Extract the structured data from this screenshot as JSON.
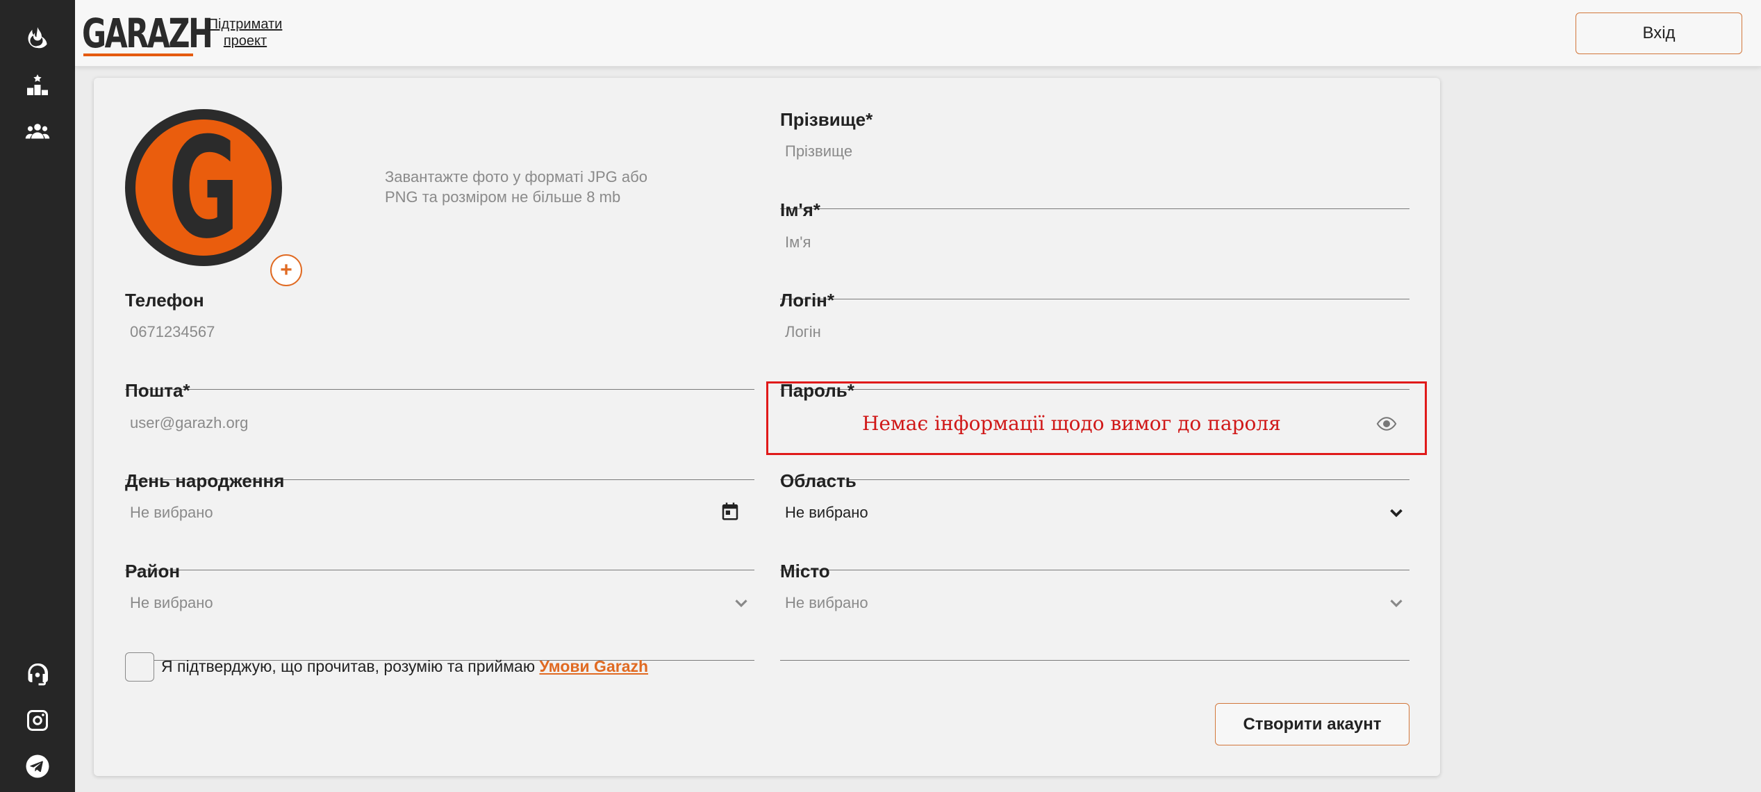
{
  "header": {
    "logo": "GARAZH",
    "support_link": "Підтримати проект",
    "login_button": "Вхід"
  },
  "sidebar": {
    "top_icons": [
      "fire-icon",
      "leaderboard-icon",
      "community-icon"
    ],
    "bottom_icons": [
      "support-headset-icon",
      "instagram-icon",
      "telegram-icon"
    ]
  },
  "form": {
    "avatar_letter": "G",
    "avatar_add": "+",
    "upload_hint": "Завантажте фото у форматі JPG або PNG та розміром не більше 8 mb",
    "surname": {
      "label": "Прізвище*",
      "placeholder": "Прізвище"
    },
    "first_name": {
      "label": "Ім'я*",
      "placeholder": "Ім'я"
    },
    "phone": {
      "label": "Телефон",
      "placeholder": "0671234567"
    },
    "login": {
      "label": "Логін*",
      "placeholder": "Логін"
    },
    "email": {
      "label": "Пошта*",
      "placeholder": "user@garazh.org"
    },
    "password": {
      "label": "Пароль*",
      "value": ""
    },
    "birthday": {
      "label": "День народження",
      "value": "Не вибрано"
    },
    "region": {
      "label": "Область",
      "value": "Не вибрано"
    },
    "district": {
      "label": "Район",
      "value": "Не вибрано"
    },
    "city": {
      "label": "Місто",
      "value": "Не вибрано"
    },
    "terms_text": "Я підтверджую, що прочитав, розумію та приймаю",
    "terms_link": "Умови Garazh",
    "create_button": "Створити акаунт"
  },
  "annotation": {
    "text": "Немає інформації щодо вимог до пароля",
    "color": "#e01a1a"
  },
  "colors": {
    "accent": "#e06a22",
    "sidebar": "#262626"
  }
}
